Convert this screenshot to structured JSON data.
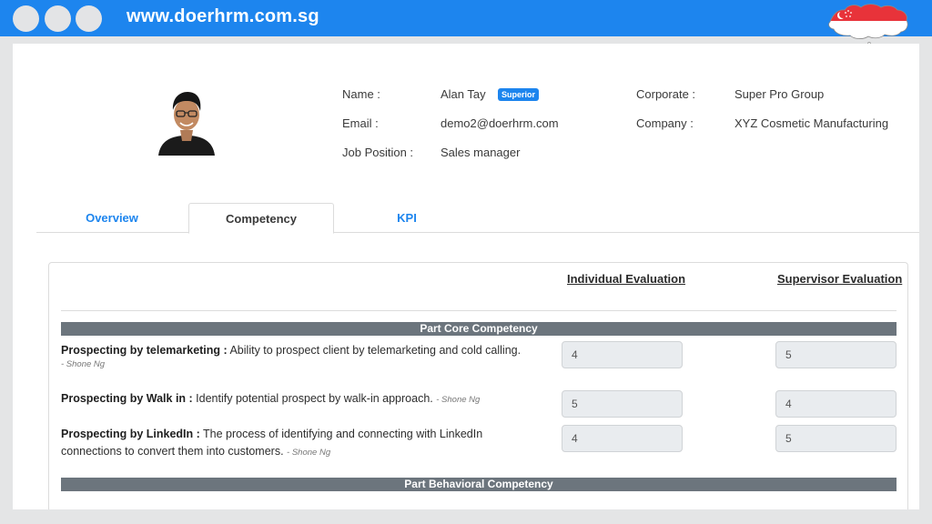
{
  "browser": {
    "url": "www.doerhrm.com.sg"
  },
  "profile": {
    "name_label": "Name :",
    "name_value": "Alan Tay",
    "badge": "Superior",
    "email_label": "Email :",
    "email_value": "demo2@doerhrm.com",
    "job_label": "Job Position :",
    "job_value": "Sales manager",
    "corporate_label": "Corporate :",
    "corporate_value": "Super Pro Group",
    "company_label": "Company :",
    "company_value": "XYZ Cosmetic Manufacturing"
  },
  "tabs": [
    {
      "label": "Overview",
      "active": false
    },
    {
      "label": "Competency",
      "active": true
    },
    {
      "label": "KPI",
      "active": false
    }
  ],
  "evaluation": {
    "col_individual": "Individual Evaluation",
    "col_supervisor": "Supervisor Evaluation",
    "sections": [
      {
        "title": "Part Core Competency",
        "items": [
          {
            "title": "Prospecting by telemarketing :",
            "desc": " Ability to prospect client by telemarketing and cold calling.",
            "author": "- Shone Ng",
            "individual": "4",
            "supervisor": "5"
          },
          {
            "title": "Prospecting by Walk in :",
            "desc": " Identify potential prospect by walk-in approach.",
            "author": "- Shone Ng",
            "individual": "5",
            "supervisor": "4"
          },
          {
            "title": "Prospecting by LinkedIn :",
            "desc": " The process of identifying and connecting with LinkedIn connections to convert them into customers.",
            "author": "- Shone Ng",
            "individual": "4",
            "supervisor": "5"
          }
        ]
      },
      {
        "title": "Part Behavioral Competency"
      }
    ]
  },
  "colors": {
    "accent": "#1d85ee",
    "section_bar": "#6c757d",
    "flag_red": "#e8333a"
  }
}
